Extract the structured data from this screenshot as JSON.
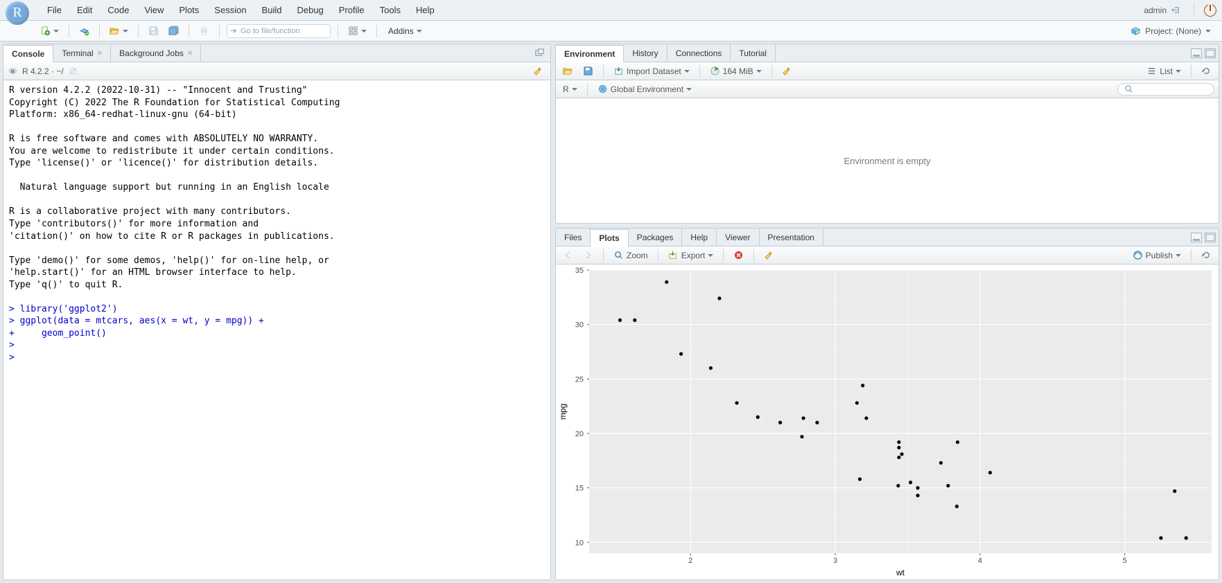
{
  "menubar": {
    "items": [
      "File",
      "Edit",
      "Code",
      "View",
      "Plots",
      "Session",
      "Build",
      "Debug",
      "Profile",
      "Tools",
      "Help"
    ],
    "user": "admin"
  },
  "toolbar": {
    "goto_placeholder": "Go to file/function",
    "addins": "Addins",
    "project": "Project: (None)"
  },
  "console": {
    "tabs": [
      "Console",
      "Terminal",
      "Background Jobs"
    ],
    "active_tab": 0,
    "version_label": "R 4.2.2 · ~/",
    "output_lines": [
      "R version 4.2.2 (2022-10-31) -- \"Innocent and Trusting\"",
      "Copyright (C) 2022 The R Foundation for Statistical Computing",
      "Platform: x86_64-redhat-linux-gnu (64-bit)",
      "",
      "R is free software and comes with ABSOLUTELY NO WARRANTY.",
      "You are welcome to redistribute it under certain conditions.",
      "Type 'license()' or 'licence()' for distribution details.",
      "",
      "  Natural language support but running in an English locale",
      "",
      "R is a collaborative project with many contributors.",
      "Type 'contributors()' for more information and",
      "'citation()' on how to cite R or R packages in publications.",
      "",
      "Type 'demo()' for some demos, 'help()' for on-line help, or",
      "'help.start()' for an HTML browser interface to help.",
      "Type 'q()' to quit R.",
      ""
    ],
    "input_lines": [
      "> library('ggplot2')",
      "> ggplot(data = mtcars, aes(x = wt, y = mpg)) +",
      "+     geom_point()",
      "> ",
      "> "
    ]
  },
  "env_pane": {
    "tabs": [
      "Environment",
      "History",
      "Connections",
      "Tutorial"
    ],
    "active_tab": 0,
    "import_label": "Import Dataset",
    "memory_label": "164 MiB",
    "view_mode": "List",
    "lang_label": "R",
    "scope_label": "Global Environment",
    "empty_message": "Environment is empty"
  },
  "plots_pane": {
    "tabs": [
      "Files",
      "Plots",
      "Packages",
      "Help",
      "Viewer",
      "Presentation"
    ],
    "active_tab": 1,
    "zoom_label": "Zoom",
    "export_label": "Export",
    "publish_label": "Publish"
  },
  "chart_data": {
    "type": "scatter",
    "title": "",
    "xlabel": "wt",
    "ylabel": "mpg",
    "xlim": [
      1.3,
      5.6
    ],
    "ylim": [
      9,
      35
    ],
    "xticks": [
      2,
      3,
      4,
      5
    ],
    "yticks": [
      10,
      15,
      20,
      25,
      30,
      35
    ],
    "series": [
      {
        "name": "mtcars",
        "points": [
          {
            "wt": 2.62,
            "mpg": 21.0
          },
          {
            "wt": 2.875,
            "mpg": 21.0
          },
          {
            "wt": 2.32,
            "mpg": 22.8
          },
          {
            "wt": 3.215,
            "mpg": 21.4
          },
          {
            "wt": 3.44,
            "mpg": 18.7
          },
          {
            "wt": 3.46,
            "mpg": 18.1
          },
          {
            "wt": 3.57,
            "mpg": 14.3
          },
          {
            "wt": 3.19,
            "mpg": 24.4
          },
          {
            "wt": 3.15,
            "mpg": 22.8
          },
          {
            "wt": 3.44,
            "mpg": 19.2
          },
          {
            "wt": 3.44,
            "mpg": 17.8
          },
          {
            "wt": 4.07,
            "mpg": 16.4
          },
          {
            "wt": 3.73,
            "mpg": 17.3
          },
          {
            "wt": 3.78,
            "mpg": 15.2
          },
          {
            "wt": 5.25,
            "mpg": 10.4
          },
          {
            "wt": 5.424,
            "mpg": 10.4
          },
          {
            "wt": 5.345,
            "mpg": 14.7
          },
          {
            "wt": 2.2,
            "mpg": 32.4
          },
          {
            "wt": 1.615,
            "mpg": 30.4
          },
          {
            "wt": 1.835,
            "mpg": 33.9
          },
          {
            "wt": 2.465,
            "mpg": 21.5
          },
          {
            "wt": 3.52,
            "mpg": 15.5
          },
          {
            "wt": 3.435,
            "mpg": 15.2
          },
          {
            "wt": 3.84,
            "mpg": 13.3
          },
          {
            "wt": 3.845,
            "mpg": 19.2
          },
          {
            "wt": 1.935,
            "mpg": 27.3
          },
          {
            "wt": 2.14,
            "mpg": 26.0
          },
          {
            "wt": 1.513,
            "mpg": 30.4
          },
          {
            "wt": 3.17,
            "mpg": 15.8
          },
          {
            "wt": 2.77,
            "mpg": 19.7
          },
          {
            "wt": 3.57,
            "mpg": 15.0
          },
          {
            "wt": 2.78,
            "mpg": 21.4
          }
        ]
      }
    ]
  }
}
